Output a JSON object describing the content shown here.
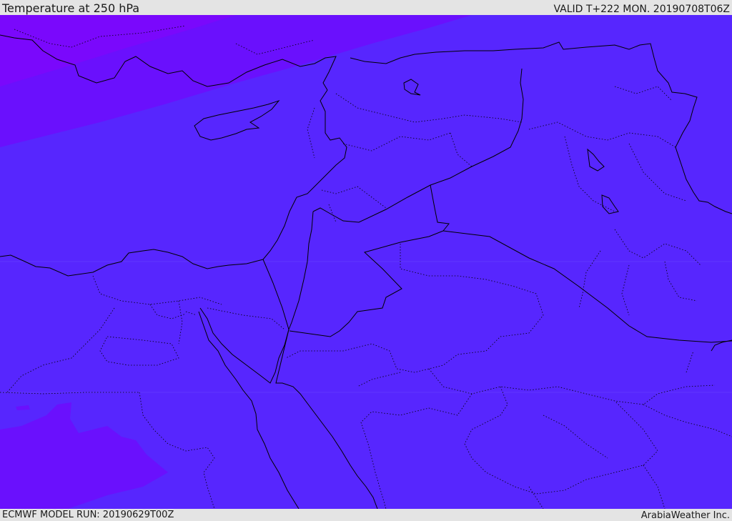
{
  "header": {
    "title": "Temperature at 250 hPa",
    "valid": "VALID T+222 MON. 20190708T06Z"
  },
  "footer": {
    "model_run": "ECMWF MODEL RUN: 20190629T00Z",
    "credit": "ArabiaWeather Inc."
  },
  "map": {
    "colors": {
      "base_fill": "#5726fe",
      "cold_band_1": "#6a10fd",
      "cold_band_2": "#7a08fc",
      "border_line": "#000000"
    }
  }
}
